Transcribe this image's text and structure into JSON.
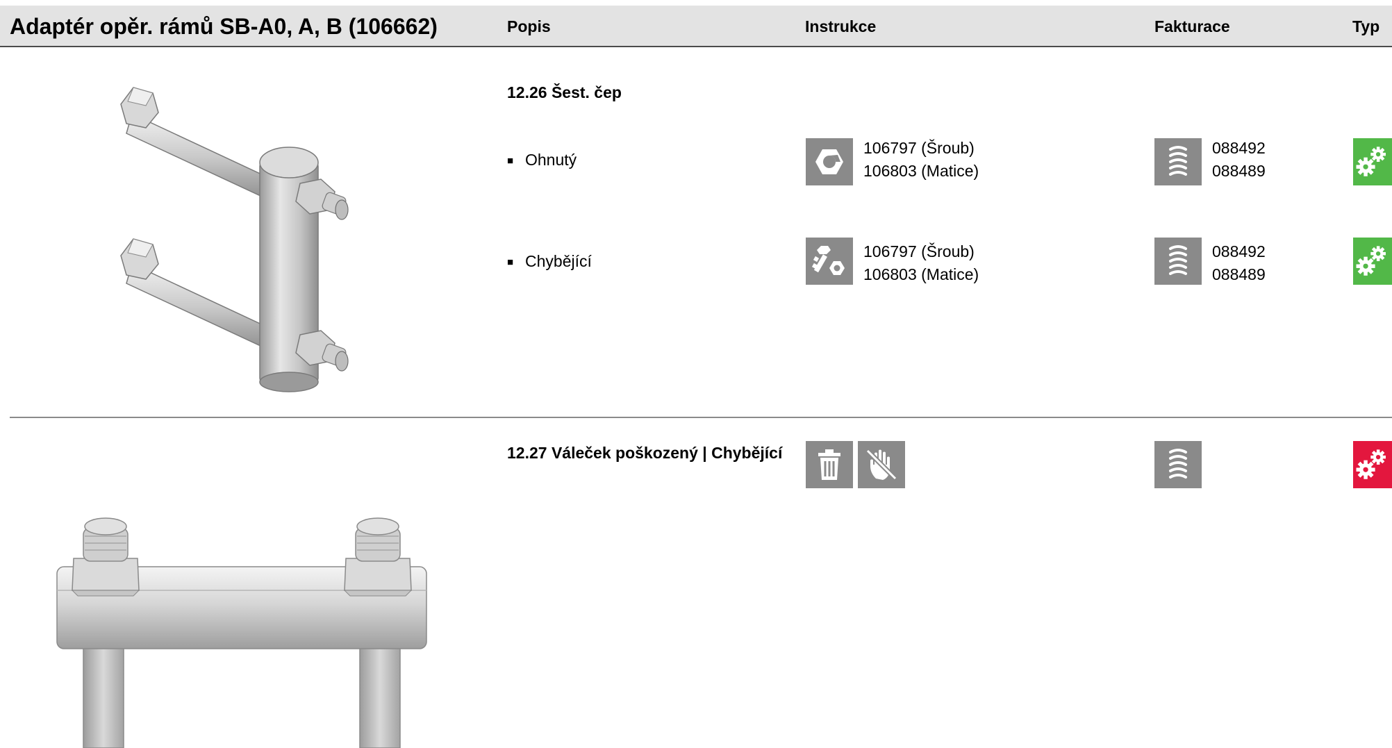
{
  "header": {
    "title": "Adaptér opěr. rámů SB-A0, A, B (106662)",
    "col_popis": "Popis",
    "col_instrukce": "Instrukce",
    "col_fakturace": "Fakturace",
    "col_typ": "Typ"
  },
  "section1": {
    "title": "12.26 Šest. čep",
    "rows": [
      {
        "label": "Ohnutý",
        "instruction_icon": "nut-icon",
        "instruction_codes": [
          "106797 (Šroub)",
          "106803 (Matice)"
        ],
        "billing_icon": "coil-spring-icon",
        "billing_codes": [
          "088492",
          "088489"
        ],
        "type_icon": "gears-icon",
        "type_color": "#52b848"
      },
      {
        "label": "Chybějící",
        "instruction_icon": "bolt-nut-icon",
        "instruction_codes": [
          "106797 (Šroub)",
          "106803 (Matice)"
        ],
        "billing_icon": "coil-spring-icon",
        "billing_codes": [
          "088492",
          "088489"
        ],
        "type_icon": "gears-icon",
        "type_color": "#52b848"
      }
    ]
  },
  "section2": {
    "title": "12.27 Váleček poškozený | Chybějící",
    "instruction_icons": [
      "trash-icon",
      "no-hand-icon"
    ],
    "billing_icon": "coil-spring-icon",
    "type_icon": "gears-icon",
    "type_color": "#e3173e"
  },
  "illustrations": {
    "section1": "hex-pin-adapter-isometric",
    "section2": "roller-adapter-front"
  }
}
